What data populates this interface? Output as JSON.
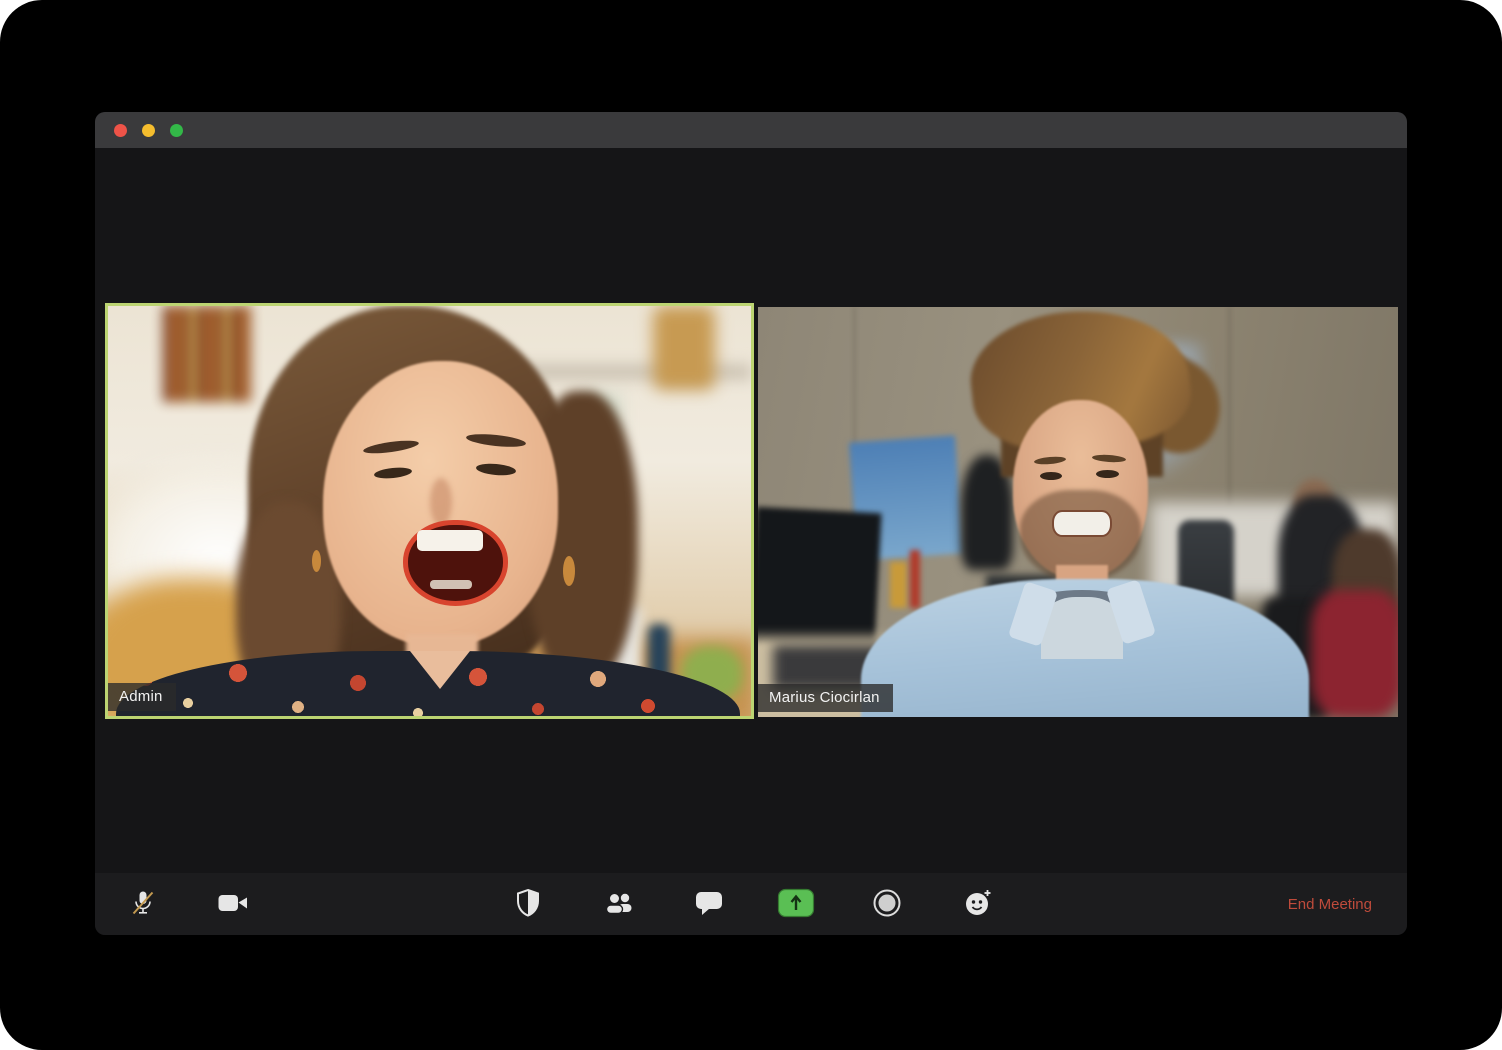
{
  "window": {
    "controls": [
      {
        "name": "close",
        "color": "#ee5348"
      },
      {
        "name": "minimize",
        "color": "#f5bd2e"
      },
      {
        "name": "zoom",
        "color": "#33b848"
      }
    ],
    "titlebar_color": "#3a3a3c",
    "content_bg": "#151517",
    "toolbar_bg": "#1c1c1e"
  },
  "participants": [
    {
      "name": "Admin",
      "active_speaker": true,
      "description": "woman laughing, floral dark top, bright cafe background"
    },
    {
      "name": "Marius Ciocirlan",
      "active_speaker": false,
      "description": "man in light denim shirt, office background with monitors and coworkers"
    }
  ],
  "colors": {
    "active_speaker_border": "#bcd472",
    "share_button_green": "#5abf54",
    "end_meeting_red": "#bf4b3b",
    "mute_slash_gold": "#c49a50"
  },
  "toolbar": {
    "buttons": [
      {
        "id": "mute",
        "icon": "microphone-muted-icon",
        "state": "muted"
      },
      {
        "id": "video",
        "icon": "video-camera-icon",
        "state": "on"
      },
      {
        "id": "security",
        "icon": "shield-icon"
      },
      {
        "id": "participants",
        "icon": "participants-icon"
      },
      {
        "id": "chat",
        "icon": "chat-bubble-icon"
      },
      {
        "id": "share-screen",
        "icon": "share-screen-arrow-icon",
        "state": "highlighted-green"
      },
      {
        "id": "record",
        "icon": "record-circle-icon"
      },
      {
        "id": "reactions",
        "icon": "smiley-plus-icon"
      }
    ],
    "end_meeting_label": "End Meeting"
  }
}
